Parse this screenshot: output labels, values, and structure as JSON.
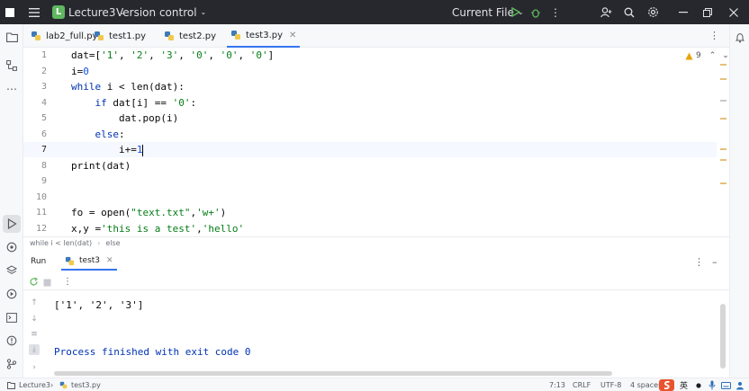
{
  "titlebar": {
    "project_badge": "L",
    "project_name": "Lecture3",
    "vcs": "Version control",
    "run_config": "Current File"
  },
  "tabs": [
    {
      "label": "lab2_full.py"
    },
    {
      "label": "test1.py"
    },
    {
      "label": "test2.py"
    },
    {
      "label": "test3.py",
      "active": true
    }
  ],
  "editor": {
    "line_numbers": [
      "1",
      "2",
      "3",
      "4",
      "5",
      "6",
      "7",
      "8",
      "9",
      "10",
      "11",
      "12"
    ],
    "warnings_count": "9"
  },
  "breadcrumb": [
    "while i < len(dat)",
    "else"
  ],
  "run_panel": {
    "title": "Run",
    "tab": "test3",
    "output": "['1', '2', '3']",
    "exit_message": "Process finished with exit code 0"
  },
  "statusbar": {
    "project": "Lecture3",
    "file": "test3.py",
    "position": "7:13",
    "line_sep": "CRLF",
    "encoding": "UTF-8",
    "indent": "4 spaces",
    "ime": "英"
  },
  "colors": {
    "titlebar_bg": "#27282e",
    "accent": "#3574f0",
    "keyword": "#0033b3",
    "string": "#067d17",
    "number": "#1750eb",
    "project_badge": "#5fb85f"
  }
}
